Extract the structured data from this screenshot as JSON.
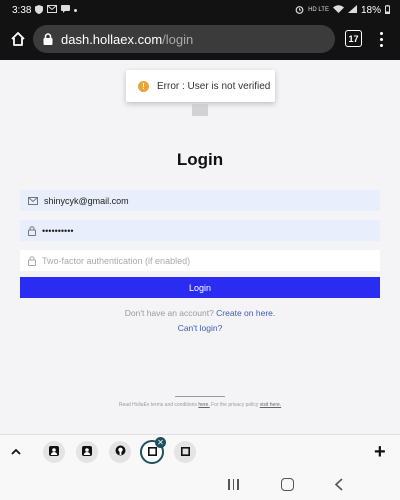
{
  "status_bar": {
    "time": "3:38",
    "left_icons": [
      "shield-icon",
      "mail-icon",
      "message-icon",
      "dot-icon"
    ],
    "right_icons": [
      "alarm-icon",
      "sim-icon",
      "wifi-icon",
      "signal-icon"
    ],
    "network": "HD LTE",
    "battery": "18%"
  },
  "browser": {
    "url_host": "dash.hollaex.com",
    "url_path": "/login",
    "tab_count": "17"
  },
  "toast": {
    "message": "Error : User is not verified",
    "icon": "warning-icon"
  },
  "login": {
    "title": "Login",
    "email_value": "shinycyk@gmail.com",
    "password_value": "••••••••••",
    "twofa_placeholder": "Two-factor authentication (if enabled)",
    "button_label": "Login",
    "no_account_text": "Don't have an account?",
    "create_link": "Create on here.",
    "cant_login": "Can't login?"
  },
  "footer": {
    "terms_prefix": "Read HollaEx terms and conditions",
    "terms_link": "here.",
    "privacy_prefix": "For the privacy policy",
    "privacy_link": "visit here."
  },
  "tabs_strip": {
    "tabs": [
      "person-icon",
      "person-icon",
      "github-icon",
      "square-icon",
      "square-icon"
    ],
    "add_label": "+"
  },
  "colors": {
    "primary_button": "#2a2cf2",
    "link": "#3c5dbf",
    "warning": "#e8a33d",
    "input_filled": "#e8eefb"
  }
}
